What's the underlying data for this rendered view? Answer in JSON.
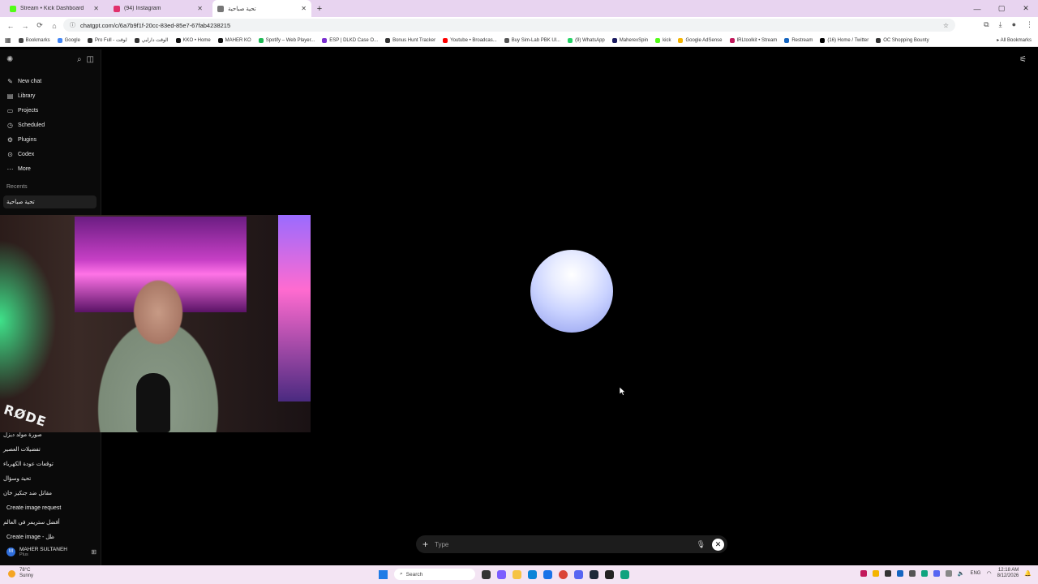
{
  "browser": {
    "tabs": [
      {
        "title": "Stream • Kick Dashboard",
        "color": "#53fc18"
      },
      {
        "title": "(94) Instagram",
        "color": "#e1306c"
      },
      {
        "title": "تحية صباحية",
        "color": "#777777",
        "active": true
      }
    ],
    "url": "chatgpt.com/c/6a7b9f1f-20cc-83ed-85e7-67fab4238215",
    "bookmarks": [
      {
        "label": "Bookmarks",
        "color": "#444"
      },
      {
        "label": "Google",
        "color": "#4285f4"
      },
      {
        "label": "Pro Full - لوقت",
        "color": "#333"
      },
      {
        "label": "الوقت دارلبي",
        "color": "#333"
      },
      {
        "label": "KKO • Home",
        "color": "#111"
      },
      {
        "label": "MAHER KO",
        "color": "#111"
      },
      {
        "label": "Spotify – Web Player...",
        "color": "#1db954"
      },
      {
        "label": "ESP | DLKD Case O...",
        "color": "#7a2fd0"
      },
      {
        "label": "Bonus Hunt Tracker",
        "color": "#333"
      },
      {
        "label": "Youtube • Broadcas...",
        "color": "#ff0000"
      },
      {
        "label": "Buy Sim-Lab PBK Ul...",
        "color": "#555"
      },
      {
        "label": "(9) WhatsApp",
        "color": "#25d366"
      },
      {
        "label": "MaherexSpin",
        "color": "#1a1a60"
      },
      {
        "label": "kick",
        "color": "#53fc18"
      },
      {
        "label": "Google AdSense",
        "color": "#f4b400"
      },
      {
        "label": "IRLtoolkit • Stream",
        "color": "#c2185b"
      },
      {
        "label": "Restream",
        "color": "#1565c0"
      },
      {
        "label": "(16) Home / Twitter",
        "color": "#000"
      },
      {
        "label": "OC Shopping Bounty",
        "color": "#333"
      }
    ],
    "all_bookmarks": "All Bookmarks"
  },
  "sidebar": {
    "nav": [
      {
        "label": "New chat",
        "icon": "✎"
      },
      {
        "label": "Library",
        "icon": "▤"
      },
      {
        "label": "Projects",
        "icon": "▭"
      },
      {
        "label": "Scheduled",
        "icon": "◷"
      },
      {
        "label": "Plugins",
        "icon": "⚙"
      },
      {
        "label": "Codex",
        "icon": "⊙"
      },
      {
        "label": "More",
        "icon": "⋯"
      }
    ],
    "recents_label": "Recents",
    "recent_active": "تحية صباحية",
    "recents": [
      {
        "label": "صورة مولد ديزل",
        "dir": "rtl"
      },
      {
        "label": "تفضيلات العصير",
        "dir": "rtl"
      },
      {
        "label": "توقعات عودة الكهرباء",
        "dir": "rtl"
      },
      {
        "label": "تحية وسؤال",
        "dir": "rtl"
      },
      {
        "label": "مقاتل ضد جنكيز خان",
        "dir": "rtl"
      },
      {
        "label": "Create image request",
        "dir": "ltr"
      },
      {
        "label": "أفضل ستريمر في العالم",
        "dir": "rtl"
      },
      {
        "label": "Create image - ظل",
        "dir": "ltr"
      }
    ],
    "user": {
      "name": "MAHER SULTANEH",
      "plan": "Plus",
      "initials": "M"
    }
  },
  "webcam": {
    "brand": "RØDE"
  },
  "composer": {
    "placeholder": "Type"
  },
  "taskbar": {
    "weather_temp": "78°C",
    "weather_desc": "Sunny",
    "search_label": "Search",
    "lang": "ENG",
    "time": "12:18 AM",
    "date": "8/12/2026"
  }
}
